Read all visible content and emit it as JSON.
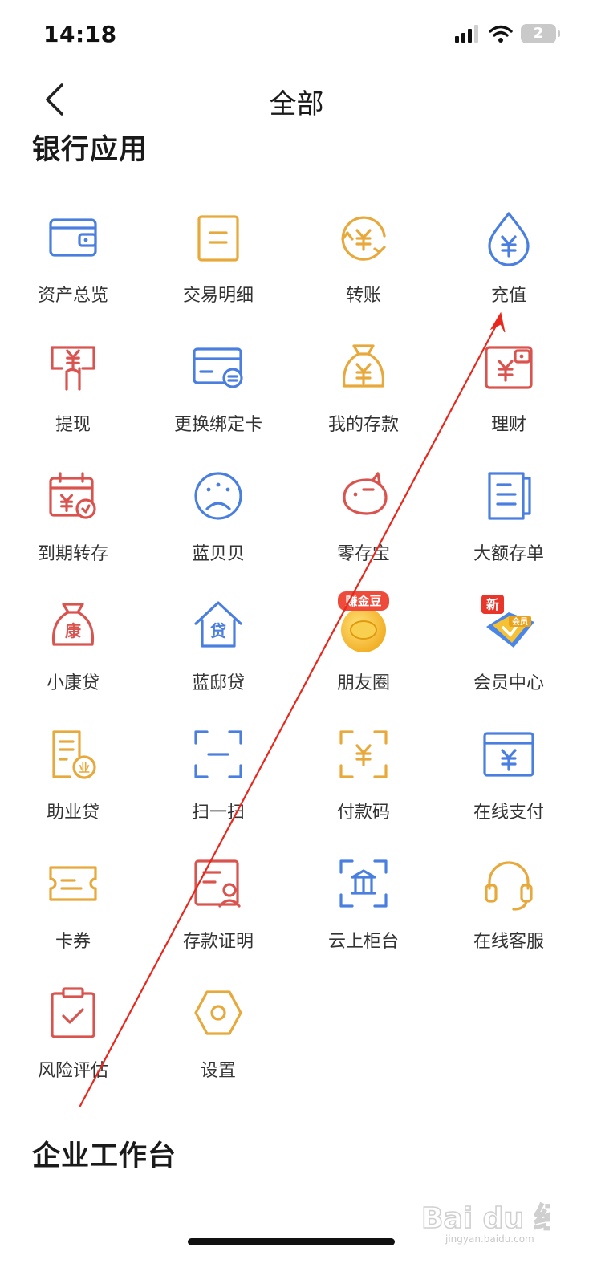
{
  "status_bar": {
    "time": "14:18",
    "battery": "2"
  },
  "nav": {
    "title": "全部"
  },
  "sections": [
    {
      "title": "银行应用"
    },
    {
      "title": "企业工作台"
    }
  ],
  "apps": [
    {
      "label": "资产总览",
      "icon": "wallet-icon",
      "color": "#4a7fe0"
    },
    {
      "label": "交易明细",
      "icon": "ledger-icon",
      "color": "#e8a93c"
    },
    {
      "label": "转账",
      "icon": "yuan-transfer-icon",
      "color": "#e8a93c"
    },
    {
      "label": "充值",
      "icon": "yuan-drop-icon",
      "color": "#4a7fe0"
    },
    {
      "label": "提现",
      "icon": "yuan-withdraw-icon",
      "color": "#d9534f"
    },
    {
      "label": "更换绑定卡",
      "icon": "bank-card-icon",
      "color": "#4a7fe0"
    },
    {
      "label": "我的存款",
      "icon": "money-bag-icon",
      "color": "#e8a93c"
    },
    {
      "label": "理财",
      "icon": "yuan-wallet-icon",
      "color": "#d9534f"
    },
    {
      "label": "到期转存",
      "icon": "calendar-yuan-icon",
      "color": "#d9534f"
    },
    {
      "label": "蓝贝贝",
      "icon": "gauge-icon",
      "color": "#4a7fe0"
    },
    {
      "label": "零存宝",
      "icon": "piggy-bank-icon",
      "color": "#d9534f"
    },
    {
      "label": "大额存单",
      "icon": "certificate-icon",
      "color": "#4a7fe0"
    },
    {
      "label": "小康贷",
      "icon": "loan-bag-icon",
      "color": "#d9534f",
      "glyph": "康"
    },
    {
      "label": "蓝邸贷",
      "icon": "house-loan-icon",
      "color": "#4a7fe0",
      "glyph": "贷"
    },
    {
      "label": "朋友圈",
      "icon": "gold-bean-icon",
      "color": "#f2b322",
      "badge": "赚金豆"
    },
    {
      "label": "会员中心",
      "icon": "member-badge-icon",
      "color": "#f2b322",
      "badge": "新",
      "sub": "会员"
    },
    {
      "label": "助业贷",
      "icon": "document-coin-icon",
      "color": "#e8a93c",
      "glyph": "业"
    },
    {
      "label": "扫一扫",
      "icon": "scan-icon",
      "color": "#4a7fe0"
    },
    {
      "label": "付款码",
      "icon": "scan-yuan-icon",
      "color": "#e8a93c"
    },
    {
      "label": "在线支付",
      "icon": "browser-yuan-icon",
      "color": "#4a7fe0"
    },
    {
      "label": "卡券",
      "icon": "ticket-icon",
      "color": "#e8a93c"
    },
    {
      "label": "存款证明",
      "icon": "certificate-person-icon",
      "color": "#d9534f"
    },
    {
      "label": "云上柜台",
      "icon": "bank-counter-icon",
      "color": "#4a7fe0"
    },
    {
      "label": "在线客服",
      "icon": "headset-icon",
      "color": "#e8a93c"
    },
    {
      "label": "风险评估",
      "icon": "clipboard-check-icon",
      "color": "#d9534f"
    },
    {
      "label": "设置",
      "icon": "settings-hex-icon",
      "color": "#e8a93c"
    }
  ],
  "annotation": {
    "color": "#e8281d"
  },
  "watermark": {
    "text": "Bai du 经验",
    "sub": "jingyan.baidu.com"
  }
}
